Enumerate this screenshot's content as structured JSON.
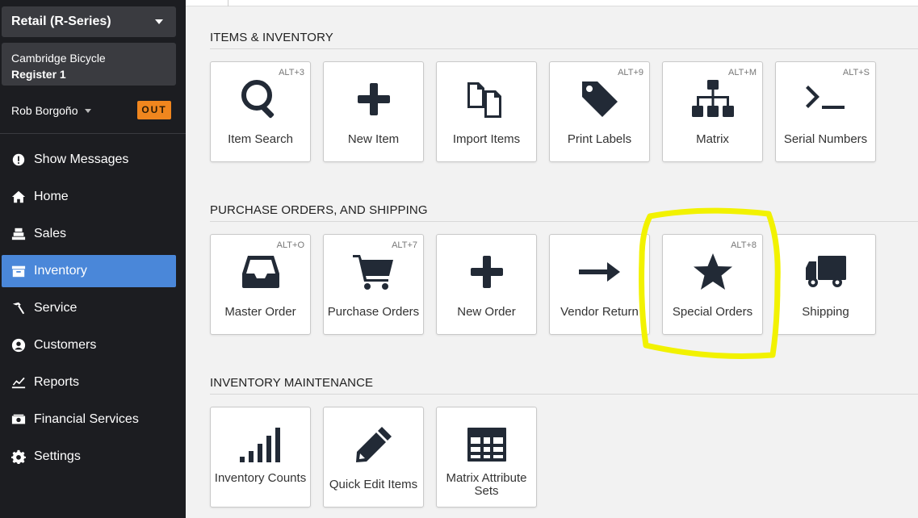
{
  "sidebar": {
    "product": "Retail (R-Series)",
    "store": "Cambridge Bicycle",
    "register": "Register 1",
    "user": "Rob Borgoño",
    "status_badge": "OUT",
    "nav": [
      {
        "label": "Show Messages",
        "icon": "info-icon"
      },
      {
        "label": "Home",
        "icon": "home-icon"
      },
      {
        "label": "Sales",
        "icon": "register-icon"
      },
      {
        "label": "Inventory",
        "icon": "inventory-icon",
        "active": true
      },
      {
        "label": "Service",
        "icon": "hammer-icon"
      },
      {
        "label": "Customers",
        "icon": "user-icon"
      },
      {
        "label": "Reports",
        "icon": "chart-icon"
      },
      {
        "label": "Financial Services",
        "icon": "money-icon"
      },
      {
        "label": "Settings",
        "icon": "gear-icon"
      }
    ]
  },
  "sections": {
    "items": {
      "title": "ITEMS & INVENTORY",
      "tiles": [
        {
          "label": "Item Search",
          "shortcut": "ALT+3",
          "icon": "search-icon"
        },
        {
          "label": "New Item",
          "shortcut": "",
          "icon": "plus-icon"
        },
        {
          "label": "Import Items",
          "shortcut": "",
          "icon": "files-icon"
        },
        {
          "label": "Print Labels",
          "shortcut": "ALT+9",
          "icon": "tag-icon"
        },
        {
          "label": "Matrix",
          "shortcut": "ALT+M",
          "icon": "sitemap-icon"
        },
        {
          "label": "Serial Numbers",
          "shortcut": "ALT+S",
          "icon": "terminal-icon"
        }
      ]
    },
    "purchase": {
      "title": "PURCHASE ORDERS, AND SHIPPING",
      "tiles": [
        {
          "label": "Master Order",
          "shortcut": "ALT+O",
          "icon": "inbox-icon"
        },
        {
          "label": "Purchase Orders",
          "shortcut": "ALT+7",
          "icon": "cart-icon"
        },
        {
          "label": "New Order",
          "shortcut": "",
          "icon": "plus-icon"
        },
        {
          "label": "Vendor Return",
          "shortcut": "",
          "icon": "arrow-right-icon"
        },
        {
          "label": "Special Orders",
          "shortcut": "ALT+8",
          "icon": "star-icon"
        },
        {
          "label": "Shipping",
          "shortcut": "",
          "icon": "truck-icon"
        }
      ]
    },
    "maintenance": {
      "title": "INVENTORY MAINTENANCE",
      "tiles": [
        {
          "label": "Inventory Counts",
          "shortcut": "",
          "icon": "signal-bars-icon"
        },
        {
          "label": "Quick Edit Items",
          "shortcut": "",
          "icon": "pencil-icon"
        },
        {
          "label": "Matrix Attribute Sets",
          "shortcut": "",
          "icon": "table-icon"
        }
      ]
    }
  },
  "colors": {
    "sidebar_bg": "#1c1d21",
    "active_nav": "#4a87d9",
    "out_badge": "#f0861e",
    "highlight": "#f2f200",
    "icon": "#222a36"
  }
}
